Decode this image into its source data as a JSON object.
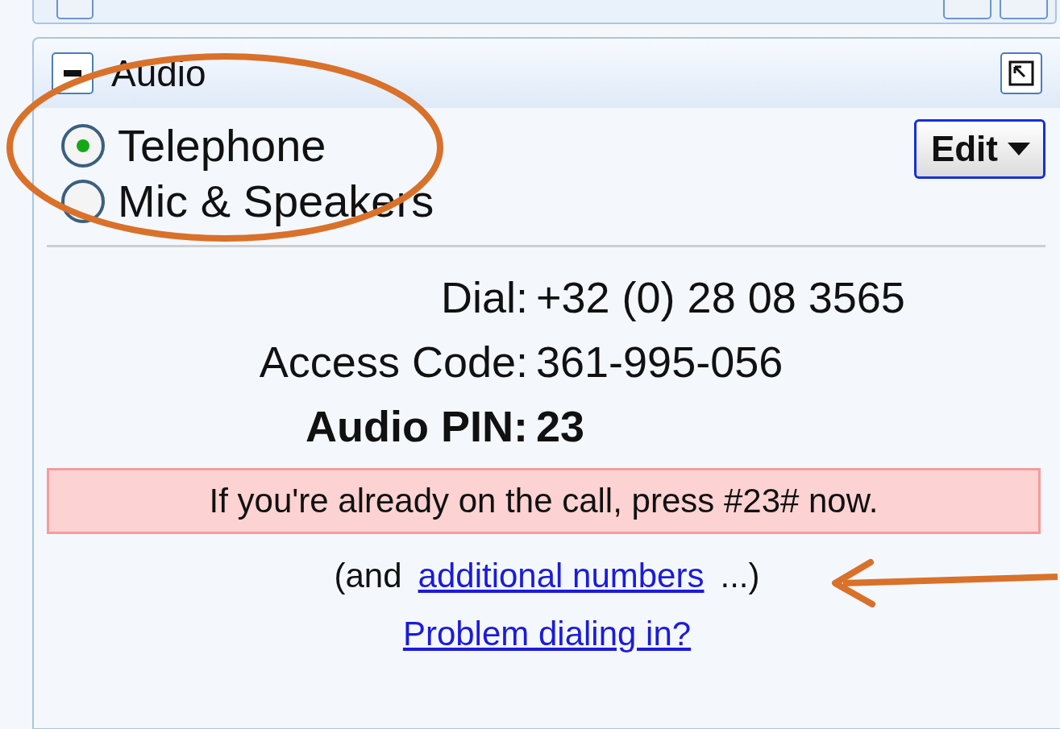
{
  "panel": {
    "title": "Audio"
  },
  "audio_options": [
    {
      "label": "Telephone",
      "selected": true
    },
    {
      "label": "Mic & Speakers",
      "selected": false
    }
  ],
  "edit_button": {
    "label": "Edit"
  },
  "dial_info": [
    {
      "label": "Dial:",
      "value": "+32 (0) 28 08 3565",
      "bold": false
    },
    {
      "label": "Access Code:",
      "value": "361-995-056",
      "bold": false
    },
    {
      "label": "Audio PIN:",
      "value": "23",
      "bold": true
    }
  ],
  "notice": "If you're already on the call, press #23# now.",
  "additional": {
    "prefix": "(and",
    "link": "additional numbers",
    "suffix": "...)"
  },
  "help_link": "Problem dialing in?"
}
